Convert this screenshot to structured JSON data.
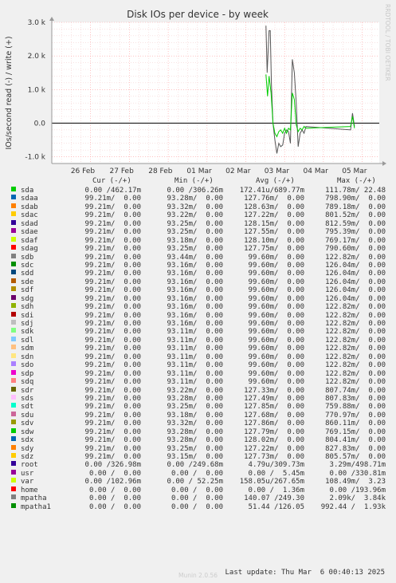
{
  "chart_data": {
    "type": "line",
    "title": "Disk IOs per device - by week",
    "ylabel": "IOs/second read (-) / write (+)",
    "ylim": [
      -1200,
      3000
    ],
    "yticks": [
      {
        "v": 3000,
        "label": "3.0 k"
      },
      {
        "v": 2000,
        "label": "2.0 k"
      },
      {
        "v": 1000,
        "label": "1.0 k"
      },
      {
        "v": 0,
        "label": "0.0"
      },
      {
        "v": -1000,
        "label": "-1.0 k"
      }
    ],
    "xticks": [
      "26 Feb",
      "27 Feb",
      "28 Feb",
      "01 Mar",
      "02 Mar",
      "03 Mar",
      "04 Mar",
      "05 Mar"
    ],
    "watermark": "RRDTOOL / TOBI OETIKER",
    "series": [
      {
        "name": "sda read",
        "color": "#555555",
        "points": [
          [
            5.52,
            2900
          ],
          [
            5.55,
            1500
          ],
          [
            5.6,
            2750
          ],
          [
            5.63,
            2750
          ],
          [
            5.66,
            1200
          ],
          [
            5.7,
            0
          ],
          [
            5.75,
            -500
          ],
          [
            5.8,
            -900
          ],
          [
            5.85,
            -600
          ],
          [
            5.9,
            -700
          ],
          [
            5.95,
            -650
          ],
          [
            6.0,
            -300
          ],
          [
            6.05,
            -200
          ],
          [
            6.1,
            -250
          ],
          [
            6.15,
            -600
          ],
          [
            6.2,
            1900
          ],
          [
            6.25,
            1500
          ],
          [
            6.3,
            600
          ],
          [
            6.35,
            -700
          ],
          [
            6.4,
            -300
          ],
          [
            6.45,
            -200
          ],
          [
            6.5,
            -300
          ],
          [
            6.55,
            -100
          ],
          [
            7.7,
            -200
          ],
          [
            7.75,
            300
          ],
          [
            7.8,
            -100
          ]
        ]
      },
      {
        "name": "sda write",
        "color": "#00cc00",
        "points": [
          [
            5.52,
            1450
          ],
          [
            5.56,
            800
          ],
          [
            5.6,
            1400
          ],
          [
            5.65,
            900
          ],
          [
            5.7,
            0
          ],
          [
            5.75,
            -300
          ],
          [
            5.8,
            -400
          ],
          [
            5.85,
            -250
          ],
          [
            5.9,
            -200
          ],
          [
            5.95,
            -300
          ],
          [
            6.0,
            -150
          ],
          [
            6.05,
            -300
          ],
          [
            6.1,
            -150
          ],
          [
            6.15,
            -200
          ],
          [
            6.2,
            900
          ],
          [
            6.25,
            700
          ],
          [
            6.3,
            -50
          ],
          [
            6.35,
            -250
          ],
          [
            6.4,
            -150
          ],
          [
            6.45,
            -200
          ],
          [
            6.5,
            -100
          ],
          [
            6.55,
            -150
          ],
          [
            7.7,
            -100
          ],
          [
            7.75,
            200
          ],
          [
            7.8,
            -150
          ]
        ]
      }
    ]
  },
  "legend_header": {
    "cur": "Cur (-/+)",
    "min": "Min (-/+)",
    "avg": "Avg (-/+)",
    "max": "Max (-/+)"
  },
  "legend": [
    {
      "name": "sda",
      "color": "#00cc00",
      "cur": "0.00 /462.17m",
      "min": "0.00 /306.26m",
      "avg": "172.41u/689.77m",
      "max": "111.78m/ 22.48"
    },
    {
      "name": "sdaa",
      "color": "#0066b3",
      "cur": "99.21m/  0.00",
      "min": "93.28m/  0.00",
      "avg": "127.76m/  0.00",
      "max": "798.90m/  0.00"
    },
    {
      "name": "sdab",
      "color": "#ff8000",
      "cur": "99.21m/  0.00",
      "min": "93.32m/  0.00",
      "avg": "128.63m/  0.00",
      "max": "789.18m/  0.00"
    },
    {
      "name": "sdac",
      "color": "#ffcc00",
      "cur": "99.21m/  0.00",
      "min": "93.22m/  0.00",
      "avg": "127.22m/  0.00",
      "max": "801.52m/  0.00"
    },
    {
      "name": "sdad",
      "color": "#330099",
      "cur": "99.21m/  0.00",
      "min": "93.25m/  0.00",
      "avg": "128.15m/  0.00",
      "max": "812.59m/  0.00"
    },
    {
      "name": "sdae",
      "color": "#990099",
      "cur": "99.21m/  0.00",
      "min": "93.25m/  0.00",
      "avg": "127.55m/  0.00",
      "max": "795.39m/  0.00"
    },
    {
      "name": "sdaf",
      "color": "#ccff00",
      "cur": "99.21m/  0.00",
      "min": "93.18m/  0.00",
      "avg": "128.10m/  0.00",
      "max": "769.17m/  0.00"
    },
    {
      "name": "sdag",
      "color": "#ff0000",
      "cur": "99.21m/  0.00",
      "min": "93.25m/  0.00",
      "avg": "127.75m/  0.00",
      "max": "790.60m/  0.00"
    },
    {
      "name": "sdb",
      "color": "#808080",
      "cur": "99.21m/  0.00",
      "min": "93.44m/  0.00",
      "avg": "99.60m/  0.00",
      "max": "122.82m/  0.00"
    },
    {
      "name": "sdc",
      "color": "#008f00",
      "cur": "99.21m/  0.00",
      "min": "93.16m/  0.00",
      "avg": "99.60m/  0.00",
      "max": "126.04m/  0.00"
    },
    {
      "name": "sdd",
      "color": "#00487d",
      "cur": "99.21m/  0.00",
      "min": "93.16m/  0.00",
      "avg": "99.60m/  0.00",
      "max": "126.04m/  0.00"
    },
    {
      "name": "sde",
      "color": "#b35a00",
      "cur": "99.21m/  0.00",
      "min": "93.16m/  0.00",
      "avg": "99.60m/  0.00",
      "max": "126.04m/  0.00"
    },
    {
      "name": "sdf",
      "color": "#b38f00",
      "cur": "99.21m/  0.00",
      "min": "93.16m/  0.00",
      "avg": "99.60m/  0.00",
      "max": "126.04m/  0.00"
    },
    {
      "name": "sdg",
      "color": "#6b006b",
      "cur": "99.21m/  0.00",
      "min": "93.16m/  0.00",
      "avg": "99.60m/  0.00",
      "max": "126.04m/  0.00"
    },
    {
      "name": "sdh",
      "color": "#8fb300",
      "cur": "99.21m/  0.00",
      "min": "93.16m/  0.00",
      "avg": "99.60m/  0.00",
      "max": "122.82m/  0.00"
    },
    {
      "name": "sdi",
      "color": "#b30000",
      "cur": "99.21m/  0.00",
      "min": "93.16m/  0.00",
      "avg": "99.60m/  0.00",
      "max": "122.82m/  0.00"
    },
    {
      "name": "sdj",
      "color": "#bebebe",
      "cur": "99.21m/  0.00",
      "min": "93.16m/  0.00",
      "avg": "99.60m/  0.00",
      "max": "122.82m/  0.00"
    },
    {
      "name": "sdk",
      "color": "#80ff80",
      "cur": "99.21m/  0.00",
      "min": "93.11m/  0.00",
      "avg": "99.60m/  0.00",
      "max": "122.82m/  0.00"
    },
    {
      "name": "sdl",
      "color": "#80c9ff",
      "cur": "99.21m/  0.00",
      "min": "93.11m/  0.00",
      "avg": "99.60m/  0.00",
      "max": "122.82m/  0.00"
    },
    {
      "name": "sdm",
      "color": "#ffc080",
      "cur": "99.21m/  0.00",
      "min": "93.11m/  0.00",
      "avg": "99.60m/  0.00",
      "max": "122.82m/  0.00"
    },
    {
      "name": "sdn",
      "color": "#ffe680",
      "cur": "99.21m/  0.00",
      "min": "93.11m/  0.00",
      "avg": "99.60m/  0.00",
      "max": "122.82m/  0.00"
    },
    {
      "name": "sdo",
      "color": "#aa80ff",
      "cur": "99.21m/  0.00",
      "min": "93.11m/  0.00",
      "avg": "99.60m/  0.00",
      "max": "122.82m/  0.00"
    },
    {
      "name": "sdp",
      "color": "#ee00cc",
      "cur": "99.21m/  0.00",
      "min": "93.11m/  0.00",
      "avg": "99.60m/  0.00",
      "max": "122.82m/  0.00"
    },
    {
      "name": "sdq",
      "color": "#ff8080",
      "cur": "99.21m/  0.00",
      "min": "93.11m/  0.00",
      "avg": "99.60m/  0.00",
      "max": "122.82m/  0.00"
    },
    {
      "name": "sdr",
      "color": "#666600",
      "cur": "99.21m/  0.00",
      "min": "93.22m/  0.00",
      "avg": "127.33m/  0.00",
      "max": "807.74m/  0.00"
    },
    {
      "name": "sds",
      "color": "#ffbfff",
      "cur": "99.21m/  0.00",
      "min": "93.28m/  0.00",
      "avg": "127.49m/  0.00",
      "max": "807.83m/  0.00"
    },
    {
      "name": "sdt",
      "color": "#00ffcc",
      "cur": "99.21m/  0.00",
      "min": "93.25m/  0.00",
      "avg": "127.85m/  0.00",
      "max": "759.88m/  0.00"
    },
    {
      "name": "sdu",
      "color": "#cc6699",
      "cur": "99.21m/  0.00",
      "min": "93.18m/  0.00",
      "avg": "127.68m/  0.00",
      "max": "770.97m/  0.00"
    },
    {
      "name": "sdv",
      "color": "#999900",
      "cur": "99.21m/  0.00",
      "min": "93.32m/  0.00",
      "avg": "127.86m/  0.00",
      "max": "860.11m/  0.00"
    },
    {
      "name": "sdw",
      "color": "#00cc00",
      "cur": "99.21m/  0.00",
      "min": "93.28m/  0.00",
      "avg": "127.79m/  0.00",
      "max": "769.15m/  0.00"
    },
    {
      "name": "sdx",
      "color": "#0066b3",
      "cur": "99.21m/  0.00",
      "min": "93.28m/  0.00",
      "avg": "128.02m/  0.00",
      "max": "804.41m/  0.00"
    },
    {
      "name": "sdy",
      "color": "#ff8000",
      "cur": "99.21m/  0.00",
      "min": "93.25m/  0.00",
      "avg": "127.22m/  0.00",
      "max": "827.83m/  0.00"
    },
    {
      "name": "sdz",
      "color": "#ffcc00",
      "cur": "99.21m/  0.00",
      "min": "93.15m/  0.00",
      "avg": "127.73m/  0.00",
      "max": "805.57m/  0.00"
    },
    {
      "name": "root",
      "color": "#330099",
      "cur": "0.00 /326.98m",
      "min": "0.00 /249.68m",
      "avg": "4.79u/309.73m",
      "max": "3.29m/498.71m"
    },
    {
      "name": "usr",
      "color": "#990099",
      "cur": "0.00 /  0.00",
      "min": "0.00 /  0.00",
      "avg": "0.00 /  5.45m",
      "max": "0.00 /330.81m"
    },
    {
      "name": "var",
      "color": "#ccff00",
      "cur": "0.00 /102.96m",
      "min": "0.00 / 52.25m",
      "avg": "158.05u/267.65m",
      "max": "108.49m/  3.23"
    },
    {
      "name": "home",
      "color": "#ff0000",
      "cur": "0.00 /  0.00",
      "min": "0.00 /  0.00",
      "avg": "0.00 /  1.36m",
      "max": "0.00 /193.96m"
    },
    {
      "name": "mpatha",
      "color": "#808080",
      "cur": "0.00 /  0.00",
      "min": "0.00 /  0.00",
      "avg": "140.07 /249.30",
      "max": "2.09k/  3.84k"
    },
    {
      "name": "mpatha1",
      "color": "#008f00",
      "cur": "0.00 /  0.00",
      "min": "0.00 /  0.00",
      "avg": "51.44 /126.05",
      "max": "992.44 /  1.93k"
    }
  ],
  "footer": "Last update: Thu Mar  6 00:40:13 2025",
  "version": "Munin 2.0.56"
}
